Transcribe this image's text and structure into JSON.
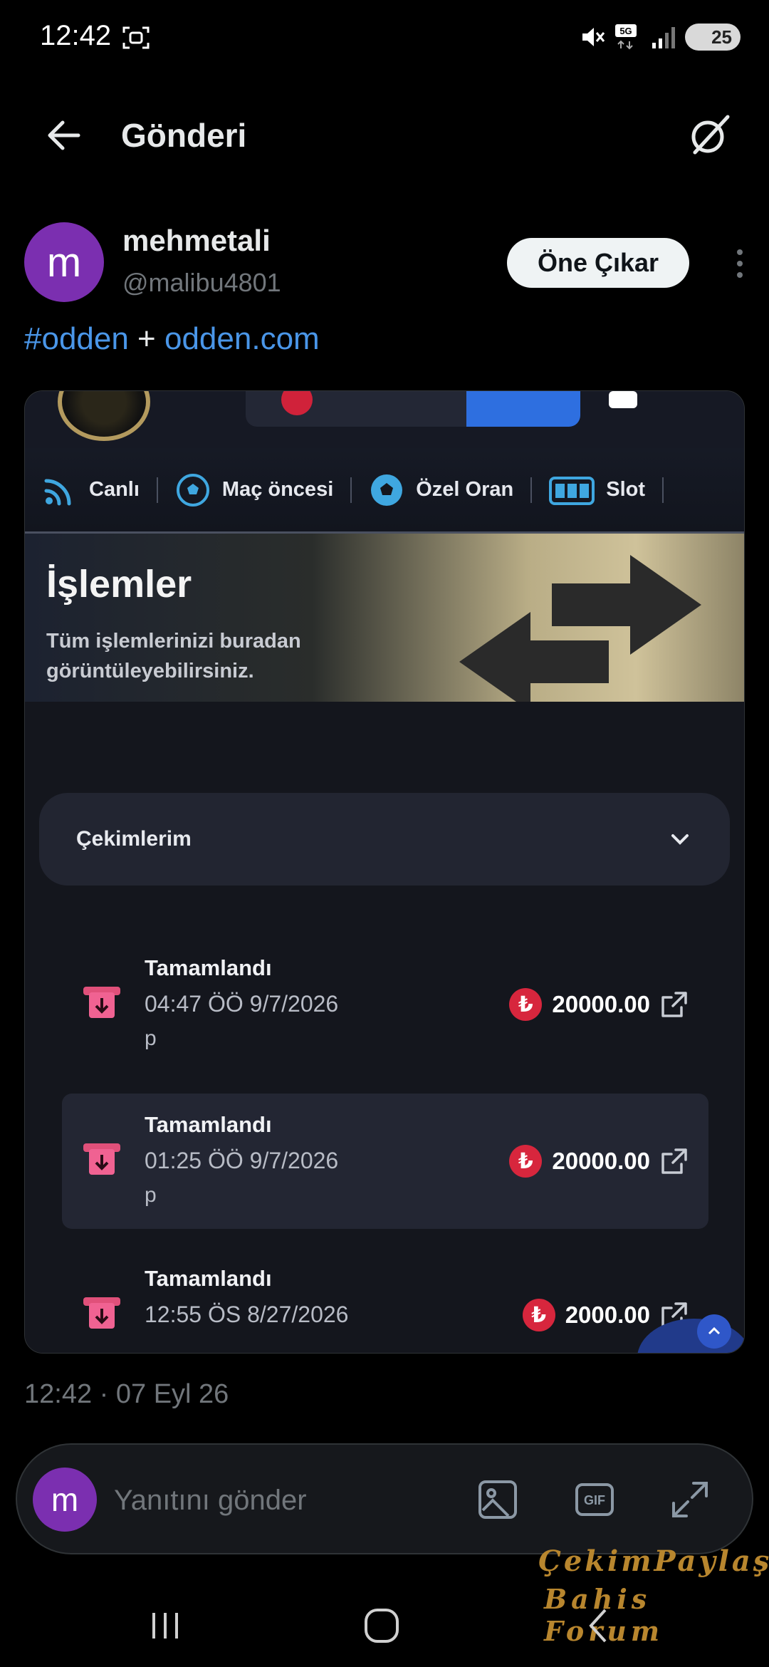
{
  "status_bar": {
    "time": "12:42",
    "battery": "25",
    "network": "5G"
  },
  "header": {
    "title": "Gönderi"
  },
  "author": {
    "avatar_letter": "m",
    "name": "mehmetali",
    "handle": "@malibu4801",
    "promote_label": "Öne Çıkar"
  },
  "post": {
    "hashtag": "#odden",
    "plus": " + ",
    "link": "odden.com"
  },
  "media": {
    "nav_items": [
      {
        "label": "Canlı",
        "icon": "live-broadcast-icon"
      },
      {
        "label": "Maç öncesi",
        "icon": "soccer-ball-icon"
      },
      {
        "label": "Özel Oran",
        "icon": "soccer-ball-icon"
      },
      {
        "label": "Slot",
        "icon": "slot-machine-icon"
      }
    ],
    "hero": {
      "title": "İşlemler",
      "subtitle": "Tüm işlemlerinizi buradan görüntüleyebilirsiniz."
    },
    "dropdown": {
      "label": "Çekimlerim"
    },
    "transactions": [
      {
        "status": "Tamamlandı",
        "date": "04:47 ÖÖ 9/7/2026",
        "extra": "p",
        "amount": "20000.00",
        "currency_symbol": "₺"
      },
      {
        "status": "Tamamlandı",
        "date": "01:25 ÖÖ 9/7/2026",
        "extra": "p",
        "amount": "20000.00",
        "currency_symbol": "₺"
      },
      {
        "status": "Tamamlandı",
        "date": "12:55 ÖS 8/27/2026",
        "extra": "",
        "amount": "2000.00",
        "currency_symbol": "₺"
      }
    ]
  },
  "timestamp": "12:42 · 07 Eyl 26",
  "reply": {
    "avatar_letter": "m",
    "placeholder": "Yanıtını gönder"
  },
  "watermark": {
    "line1": "ÇekimPaylaş",
    "line2": "Bahis Forum"
  },
  "colors": {
    "link": "#4a96e8",
    "avatar": "#7b2fb0",
    "lira": "#d7263d"
  }
}
